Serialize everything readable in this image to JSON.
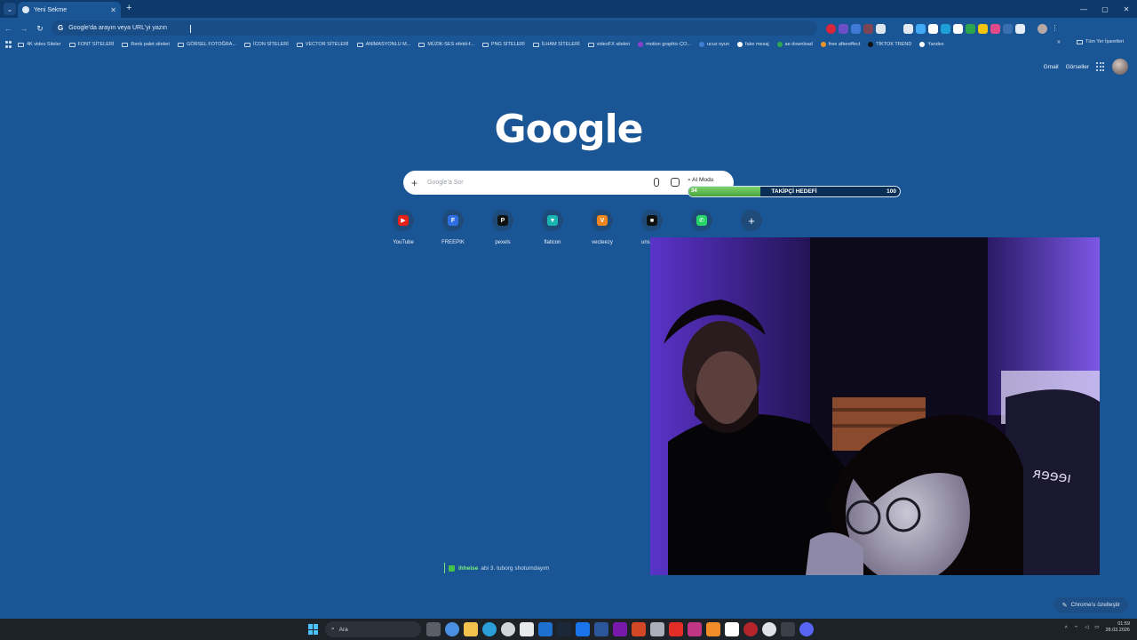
{
  "browser": {
    "tab_title": "Yeni Sekme",
    "omnibox_placeholder": "Google'da arayın veya URL'yi yazın",
    "omnibox_g": "G"
  },
  "bookmarks": [
    {
      "label": "4K video Siteler",
      "type": "folder"
    },
    {
      "label": "FONT SİTELERİ",
      "type": "folder"
    },
    {
      "label": "Renk palet siteleri",
      "type": "folder"
    },
    {
      "label": "GÖRSEL FOTOĞRA...",
      "type": "folder"
    },
    {
      "label": "İCON SİTELERİ",
      "type": "folder"
    },
    {
      "label": "VECTOR SİTELERİ",
      "type": "folder"
    },
    {
      "label": "ANİMASYONLU M...",
      "type": "folder"
    },
    {
      "label": "MÜZİK-SES efekti-f...",
      "type": "folder"
    },
    {
      "label": "PNG SİTELERİ",
      "type": "folder"
    },
    {
      "label": "İLHAM SİTELERİ",
      "type": "folder"
    },
    {
      "label": "videoFX siteleri",
      "type": "folder"
    },
    {
      "label": "motion graphic-ÇO...",
      "type": "link",
      "color": "#8b3fd1"
    },
    {
      "label": "ucuz oyun",
      "type": "link",
      "color": "#3f7fd1"
    },
    {
      "label": "fake mesaj",
      "type": "link",
      "color": "#ffffff"
    },
    {
      "label": "ae download",
      "type": "link",
      "color": "#2fa84f"
    },
    {
      "label": "free aftereffect",
      "type": "link",
      "color": "#e8962a"
    },
    {
      "label": "TİKTOK TREND",
      "type": "link",
      "color": "#111111"
    },
    {
      "label": "Yandex",
      "type": "link",
      "color": "#ffffff"
    }
  ],
  "bookmarks_all": "Tüm Yer İşaretleri",
  "bookmarks_more": "»",
  "header": {
    "gmail": "Gmail",
    "images": "Görseller"
  },
  "logo_text": "Google",
  "search": {
    "placeholder": "Google'a Sor",
    "ai_mode": "AI Modu"
  },
  "follower_goal": {
    "label": "TAKİPÇİ HEDEFİ",
    "current": 34,
    "target": 100
  },
  "shortcuts": [
    {
      "label": "YouTube",
      "color": "#e62117",
      "glyph": "▶"
    },
    {
      "label": "FREEPIK",
      "color": "#2f6fe4",
      "glyph": "F"
    },
    {
      "label": "pexels",
      "color": "#111111",
      "glyph": "P"
    },
    {
      "label": "flaticon",
      "color": "#1bb5b1",
      "glyph": "▼"
    },
    {
      "label": "vecteezy",
      "color": "#f0871e",
      "glyph": "V"
    },
    {
      "label": "unsplash",
      "color": "#111111",
      "glyph": "■"
    },
    {
      "label": "",
      "color": "#25d366",
      "glyph": "✆"
    }
  ],
  "add_shortcut_glyph": "+",
  "chat": {
    "user": "ihheise",
    "message": "abi 3. tuborg shotumdayım"
  },
  "customize_label": "Chrome'u özelleştir",
  "taskbar": {
    "search_label": "Ara",
    "time": "01:59",
    "date": "28.03.2026"
  }
}
